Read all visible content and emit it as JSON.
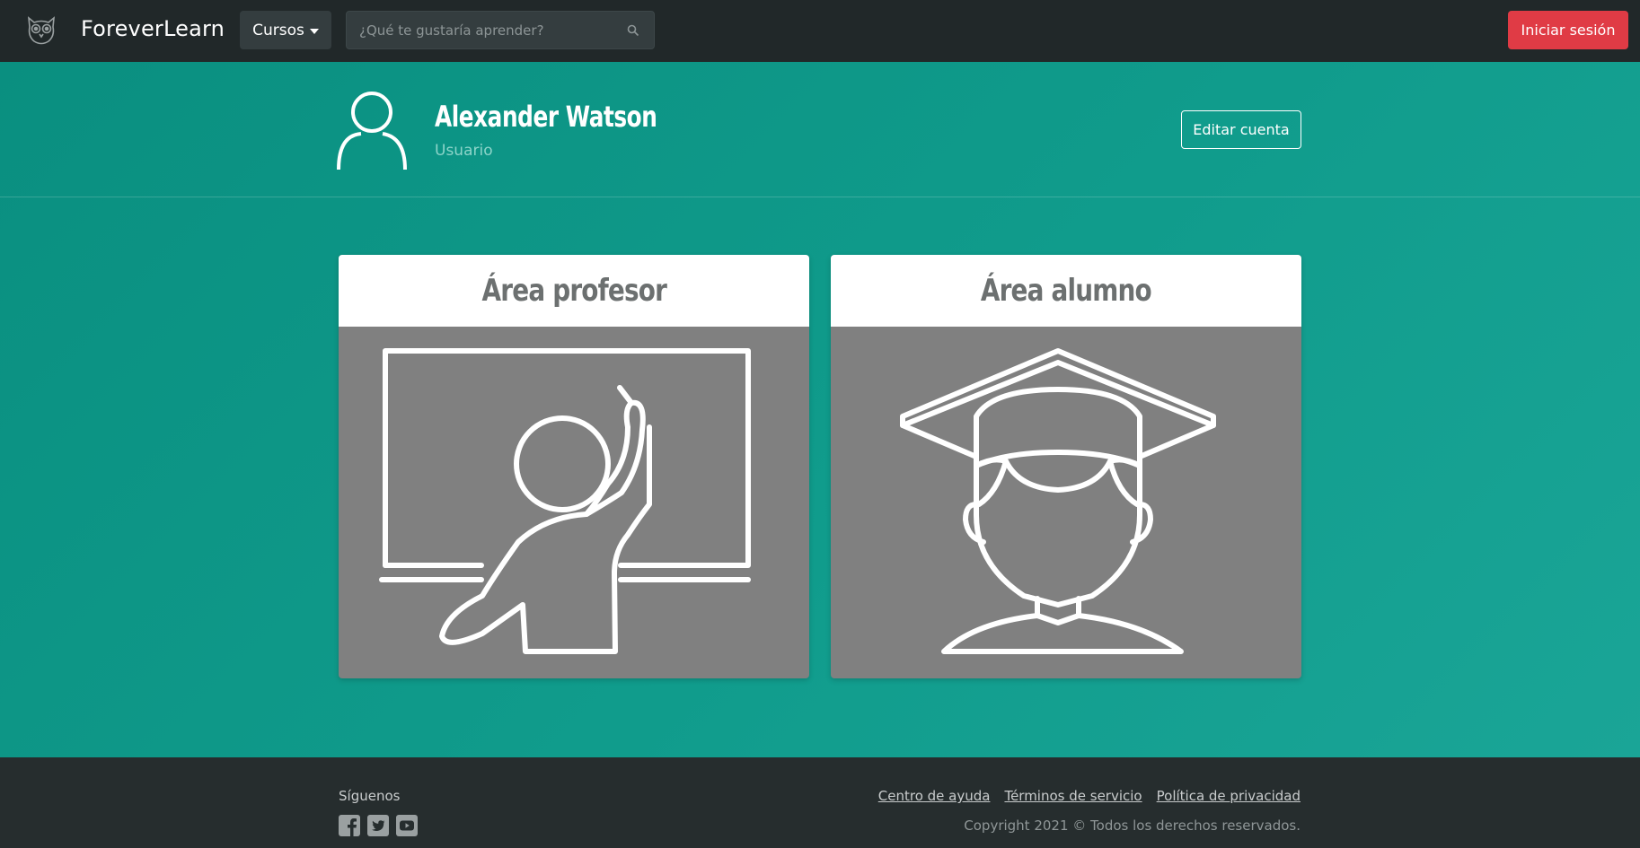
{
  "navbar": {
    "brand": "ForeverLearn",
    "courses_label": "Cursos",
    "search_placeholder": "¿Qué te gustaría aprender?",
    "login_label": "Iniciar sesión"
  },
  "profile": {
    "name": "Alexander Watson",
    "role": "Usuario",
    "edit_label": "Editar cuenta"
  },
  "cards": {
    "teacher": {
      "title": "Área profesor",
      "icon": "teacher-at-board-icon"
    },
    "student": {
      "title": "Área alumno",
      "icon": "graduate-icon"
    }
  },
  "footer": {
    "follow_label": "Síguenos",
    "social": [
      "facebook-icon",
      "twitter-icon",
      "youtube-icon"
    ],
    "links": [
      "Centro de ayuda",
      "Términos de servicio",
      "Política de privacidad"
    ],
    "copyright": "Copyright 2021 © Todos los derechos reservados."
  },
  "colors": {
    "navbar_bg": "#212829",
    "accent_teal": "#0e978a",
    "login_red": "#e03b45",
    "card_gray": "#808080",
    "footer_bg": "#262d2e"
  }
}
